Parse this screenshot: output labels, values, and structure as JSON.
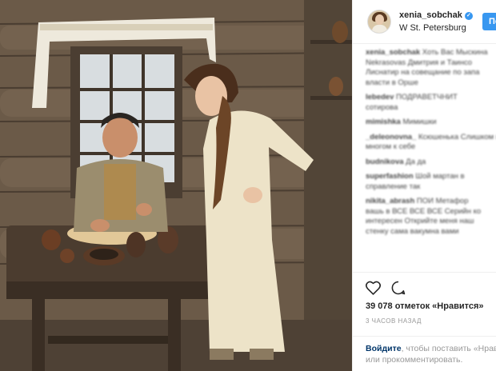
{
  "post": {
    "username": "xenia_sobchak",
    "location": "W St. Petersburg",
    "follow_label": "Подписаться",
    "likes": "39 078 отметок «Нравится»",
    "time_ago": "3 ЧАСОВ НАЗАД"
  },
  "comments": [
    {
      "user": "xenia_sobchak",
      "text": "Хоть Вас Мыскина"
    },
    {
      "user": "",
      "text": "Nekrasovas Дмитрия и Таинсо"
    },
    {
      "user": "",
      "text": "Лиснатир на совещание по запа"
    },
    {
      "user": "",
      "text": "власти в Орше"
    },
    {
      "user": "lebedev",
      "text": "ПОДРАВЕТЧНИТ"
    },
    {
      "user": "",
      "text": "сотирова"
    },
    {
      "user": "mimishka",
      "text": "Мимишки"
    },
    {
      "user": "_deleonovna_",
      "text": "Ксюшенька Слишком выход"
    },
    {
      "user": "",
      "text": "многом к себе"
    },
    {
      "user": "budnikova",
      "text": "Да да"
    },
    {
      "user": "superfashion",
      "text": "Шой мартан в"
    },
    {
      "user": "",
      "text": "справление так"
    },
    {
      "user": "nikita_abrash",
      "text": "ПОИ Метафор"
    },
    {
      "user": "",
      "text": "вашь в ВСЕ ВСЕ ВСЕ Серийн ко"
    },
    {
      "user": "",
      "text": "интересен Открийте меня наш"
    },
    {
      "user": "",
      "text": "стенку сама вакумна вами"
    }
  ],
  "icons": {
    "verified": "verified-badge-icon",
    "like": "heart-icon",
    "comment": "comment-bubble-icon"
  },
  "footer": {
    "login_link": "Войдите",
    "login_text_1": ", чтобы поставить «Нравится»",
    "login_text_2": "или прокомментировать."
  },
  "colors": {
    "accent": "#3897f0",
    "link": "#003569",
    "text": "#262626",
    "muted": "#999999"
  }
}
